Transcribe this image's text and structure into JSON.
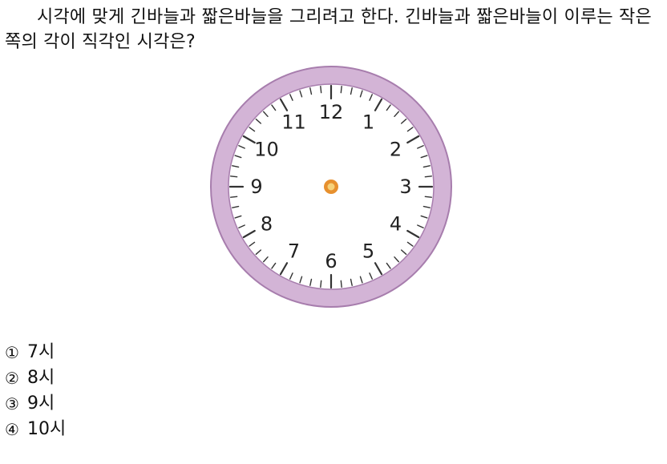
{
  "question": {
    "text": "시각에 맞게 긴바늘과 짧은바늘을 그리려고 한다. 긴바늘과 짧은바늘이 이루는 작은 쪽의 각이 직각인 시각은?"
  },
  "clock": {
    "numbers": [
      "12",
      "1",
      "2",
      "3",
      "4",
      "5",
      "6",
      "7",
      "8",
      "9",
      "10",
      "11"
    ],
    "colors": {
      "rim": "#d3b4d6",
      "rim_stroke": "#a77dad",
      "face": "#ffffff",
      "tick": "#333333",
      "center_outer": "#e7902e",
      "center_inner": "#f6d27a"
    }
  },
  "choices": [
    {
      "num": "①",
      "label": "7시"
    },
    {
      "num": "②",
      "label": "8시"
    },
    {
      "num": "③",
      "label": "9시"
    },
    {
      "num": "④",
      "label": "10시"
    }
  ]
}
